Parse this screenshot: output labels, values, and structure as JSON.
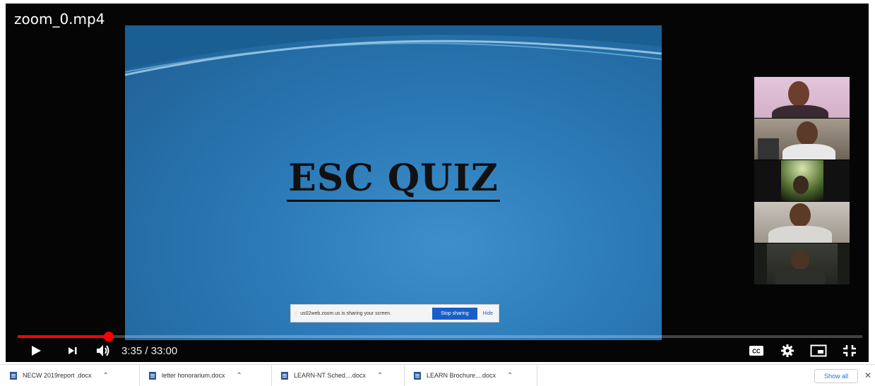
{
  "player": {
    "title": "zoom_0.mp4",
    "slide": {
      "title": "ESC QUIZ",
      "share_bar": {
        "message": "us02web.zoom.us is sharing your screen.",
        "stop_label": "Stop sharing",
        "hide_label": "Hide"
      }
    },
    "participants_count": 5,
    "progress_fraction": 0.108,
    "time_display": "3:35 / 33:00",
    "icons": {
      "play": "play-icon",
      "next": "skip-next-icon",
      "volume": "volume-icon",
      "captions": "closed-captions-icon",
      "settings": "gear-icon",
      "miniplayer": "miniplayer-icon",
      "fullscreen_exit": "exit-fullscreen-icon"
    }
  },
  "downloads": {
    "items": [
      {
        "name": "NECW 2019report .docx"
      },
      {
        "name": "letter honorarium.docx"
      },
      {
        "name": "LEARN-NT Sched....docx"
      },
      {
        "name": "LEARN Brochure....docx"
      }
    ],
    "show_all_label": "Show all",
    "close_glyph": "✕"
  },
  "colors": {
    "progress": "#ff0000",
    "slide_blue": "#2a78b5",
    "download_icon": "#2b579a",
    "link_blue": "#1a73e8"
  }
}
